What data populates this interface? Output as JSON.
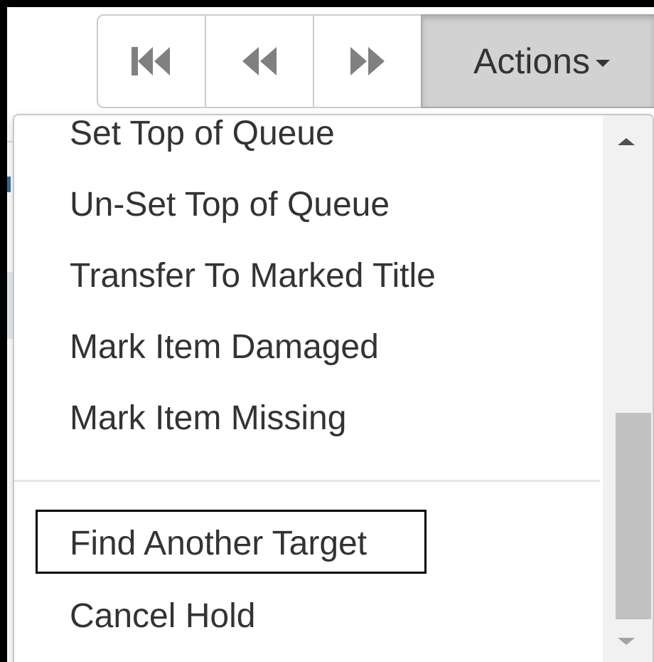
{
  "toolbar": {
    "buttons": [
      {
        "name": "first-page-button",
        "icon": "skip-to-start-icon"
      },
      {
        "name": "previous-page-button",
        "icon": "rewind-icon"
      },
      {
        "name": "next-page-button",
        "icon": "fast-forward-icon"
      }
    ],
    "actions_label": "Actions",
    "actions_icon": "caret-down-icon"
  },
  "menu": {
    "items": [
      {
        "label": "Set Top of Queue"
      },
      {
        "label": "Un-Set Top of Queue"
      },
      {
        "label": "Transfer To Marked Title"
      },
      {
        "label": "Mark Item Damaged"
      },
      {
        "label": "Mark Item Missing"
      },
      {
        "label": "Find Another Target",
        "focused": true
      },
      {
        "label": "Cancel Hold"
      }
    ]
  },
  "colors": {
    "icon_gray": "#808080",
    "text": "#333333",
    "active_button_bg": "#d2d2d2"
  }
}
